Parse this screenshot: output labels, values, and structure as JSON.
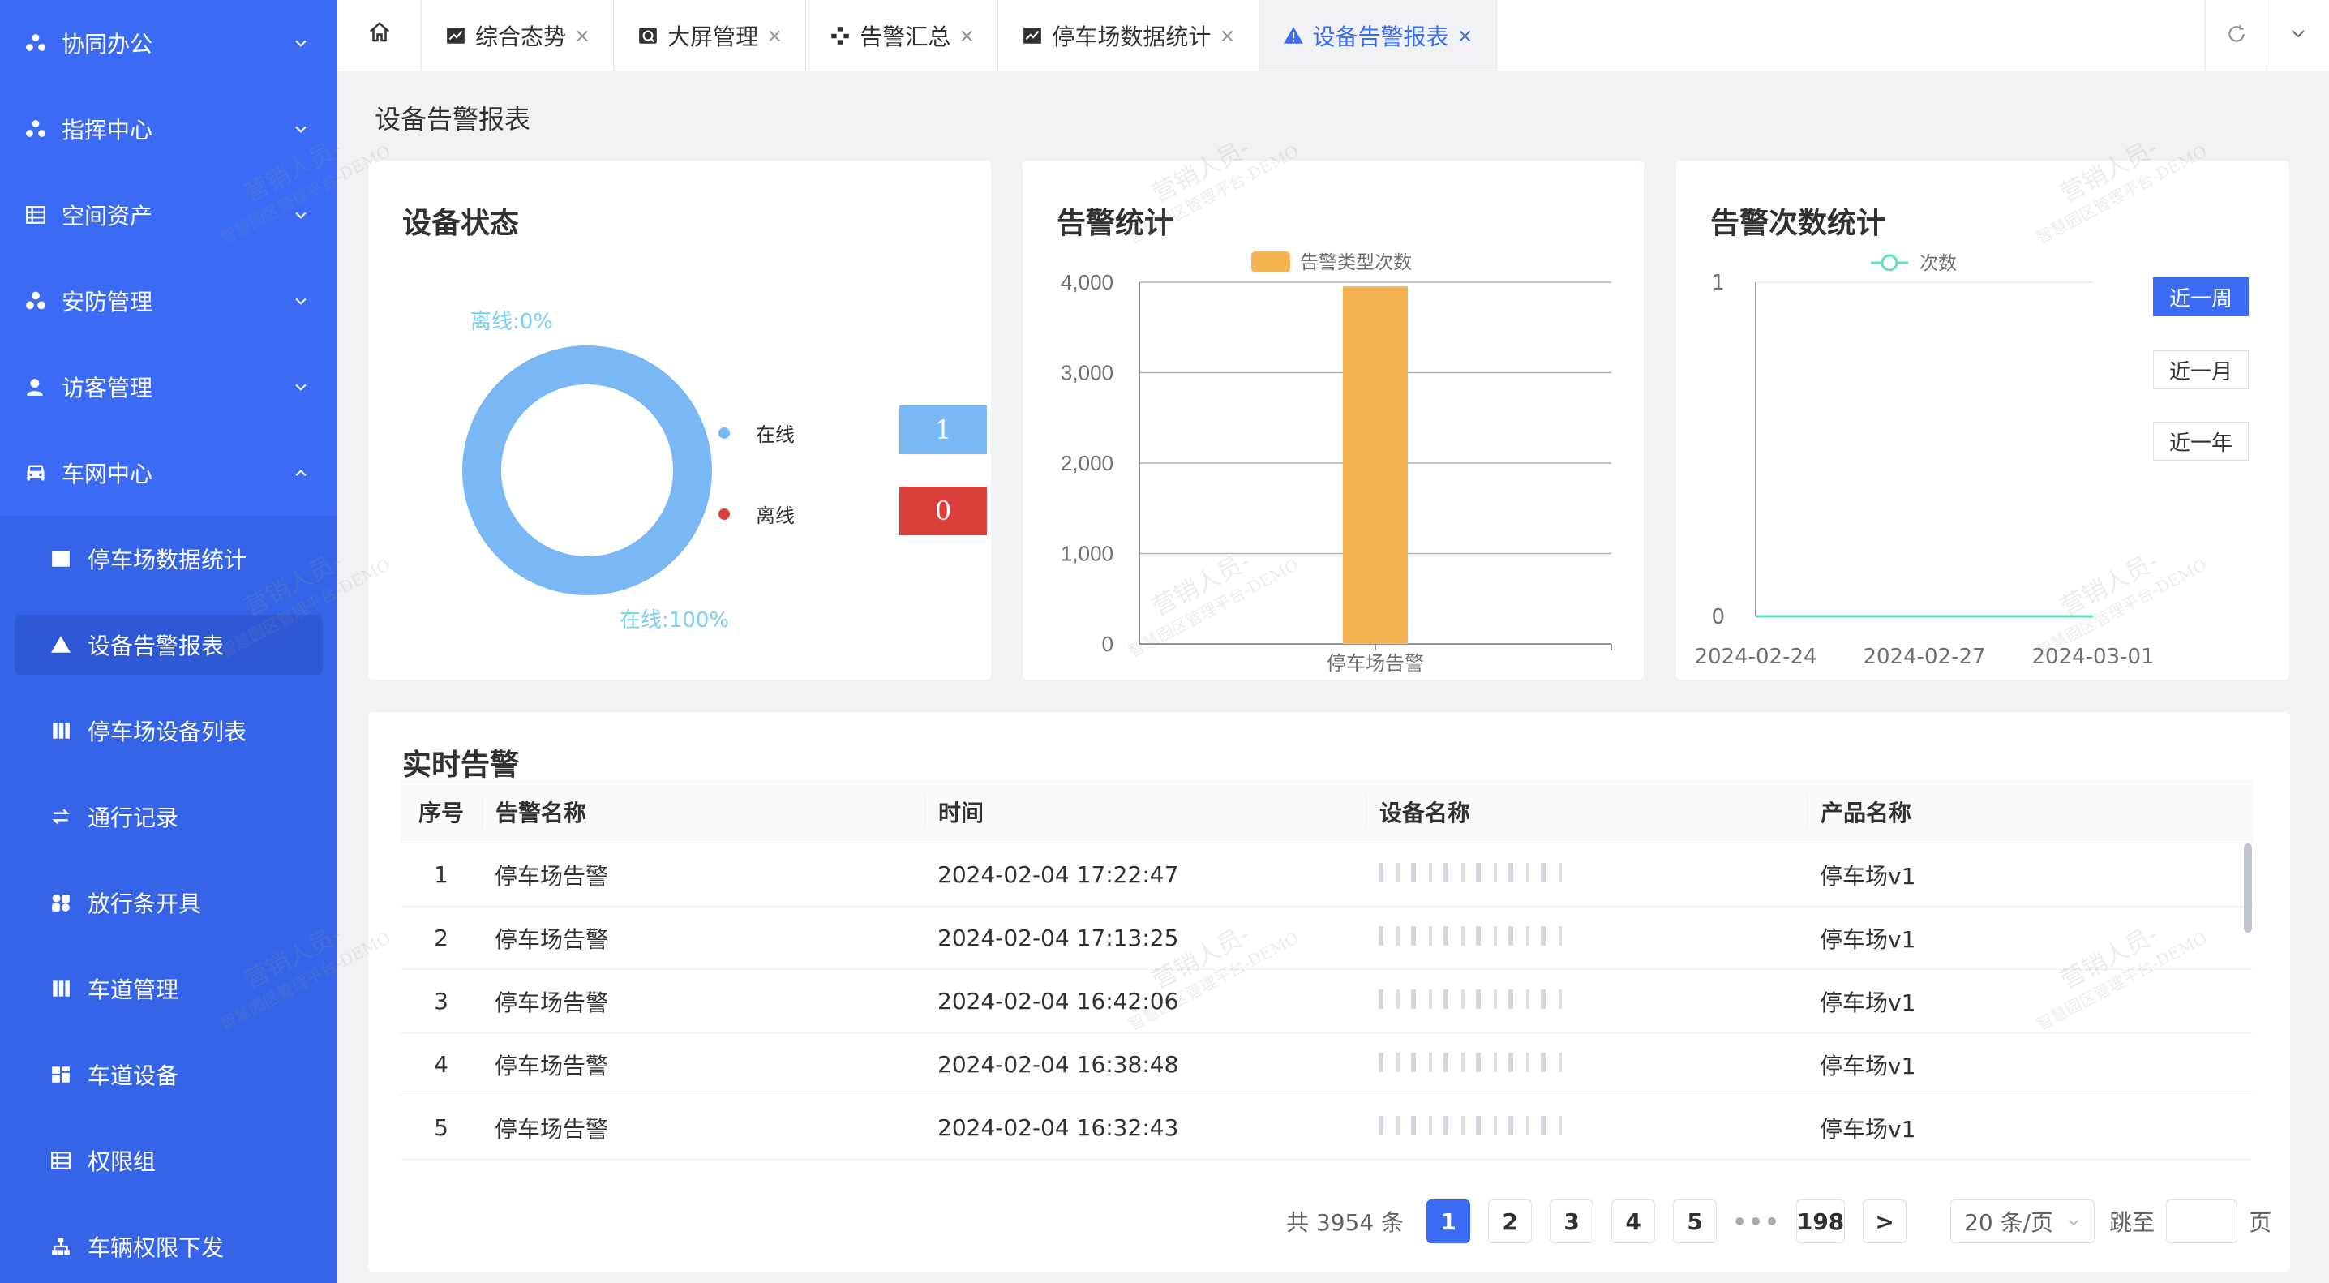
{
  "sidebar": {
    "groups": [
      {
        "label": "协同办公",
        "icon": "cluster-icon",
        "expanded": false
      },
      {
        "label": "指挥中心",
        "icon": "cluster-icon",
        "expanded": false
      },
      {
        "label": "空间资产",
        "icon": "table-icon",
        "expanded": false
      },
      {
        "label": "安防管理",
        "icon": "shield-cluster-icon",
        "expanded": false
      },
      {
        "label": "访客管理",
        "icon": "user-icon",
        "expanded": false
      },
      {
        "label": "车网中心",
        "icon": "car-icon",
        "expanded": true
      }
    ],
    "sub_items": [
      {
        "label": "停车场数据统计",
        "icon": "line-chart-icon"
      },
      {
        "label": "设备告警报表",
        "icon": "warning-icon",
        "active": true
      },
      {
        "label": "停车场设备列表",
        "icon": "columns-icon"
      },
      {
        "label": "通行记录",
        "icon": "transfer-icon"
      },
      {
        "label": "放行条开具",
        "icon": "grid-icon"
      },
      {
        "label": "车道管理",
        "icon": "columns-icon"
      },
      {
        "label": "车道设备",
        "icon": "device-icon"
      },
      {
        "label": "权限组",
        "icon": "table-icon"
      },
      {
        "label": "车辆权限下发",
        "icon": "tree-icon"
      }
    ]
  },
  "tabs": [
    {
      "label": "综合态势",
      "icon": "line-chart-icon"
    },
    {
      "label": "大屏管理",
      "icon": "screen-icon"
    },
    {
      "label": "告警汇总",
      "icon": "flow-icon"
    },
    {
      "label": "停车场数据统计",
      "icon": "line-chart-icon"
    },
    {
      "label": "设备告警报表",
      "icon": "warning-icon",
      "active": true
    }
  ],
  "tab_close": "×",
  "page_title": "设备告警报表",
  "device_status": {
    "title": "设备状态",
    "offline_label": "离线:0%",
    "online_label": "在线:100%",
    "legend_online": "在线",
    "legend_offline": "离线",
    "online_count": "1",
    "offline_count": "0",
    "online_percent": 100,
    "colors": {
      "online": "#7ab8f5",
      "offline": "#d9403a",
      "online_box": "#7ab8f5"
    }
  },
  "alarm_stats": {
    "title": "告警统计",
    "chart_data": {
      "type": "bar",
      "categories": [
        "停车场告警"
      ],
      "series": [
        {
          "name": "告警类型次数",
          "values": [
            3954
          ]
        }
      ],
      "ylim": [
        0,
        4000
      ],
      "yticks": [
        "4,000",
        "3,000",
        "2,000",
        "1,000",
        "0"
      ],
      "color": "#f5b351"
    }
  },
  "alarm_count": {
    "title": "告警次数统计",
    "chart_data": {
      "type": "line",
      "x": [
        "2024-02-24",
        "2024-02-27",
        "2024-03-01"
      ],
      "series": [
        {
          "name": "次数",
          "values": [
            0,
            0,
            0
          ]
        }
      ],
      "ylim": [
        0,
        1
      ],
      "yticks": [
        "1",
        "0"
      ],
      "color": "#5fe0c0"
    },
    "ranges": [
      "近一周",
      "近一月",
      "近一年"
    ],
    "active_range": "近一周"
  },
  "realtime": {
    "title": "实时告警",
    "columns": [
      "序号",
      "告警名称",
      "时间",
      "设备名称",
      "产品名称"
    ],
    "rows": [
      {
        "no": "1",
        "name": "停车场告警",
        "time": "2024-02-04 17:22:47",
        "product": "停车场v1"
      },
      {
        "no": "2",
        "name": "停车场告警",
        "time": "2024-02-04 17:13:25",
        "product": "停车场v1"
      },
      {
        "no": "3",
        "name": "停车场告警",
        "time": "2024-02-04 16:42:06",
        "product": "停车场v1"
      },
      {
        "no": "4",
        "name": "停车场告警",
        "time": "2024-02-04 16:38:48",
        "product": "停车场v1"
      },
      {
        "no": "5",
        "name": "停车场告警",
        "time": "2024-02-04 16:32:43",
        "product": "停车场v1"
      }
    ]
  },
  "pagination": {
    "total": "共 3954 条",
    "pages": [
      "1",
      "2",
      "3",
      "4",
      "5"
    ],
    "ellipsis": "•••",
    "last": "198",
    "next": ">",
    "page_size": "20 条/页",
    "jump_label": "跳至",
    "jump_suffix": "页"
  },
  "watermark": {
    "line1": "营销人员-",
    "line2": "智慧园区管理平台-DEMO"
  }
}
